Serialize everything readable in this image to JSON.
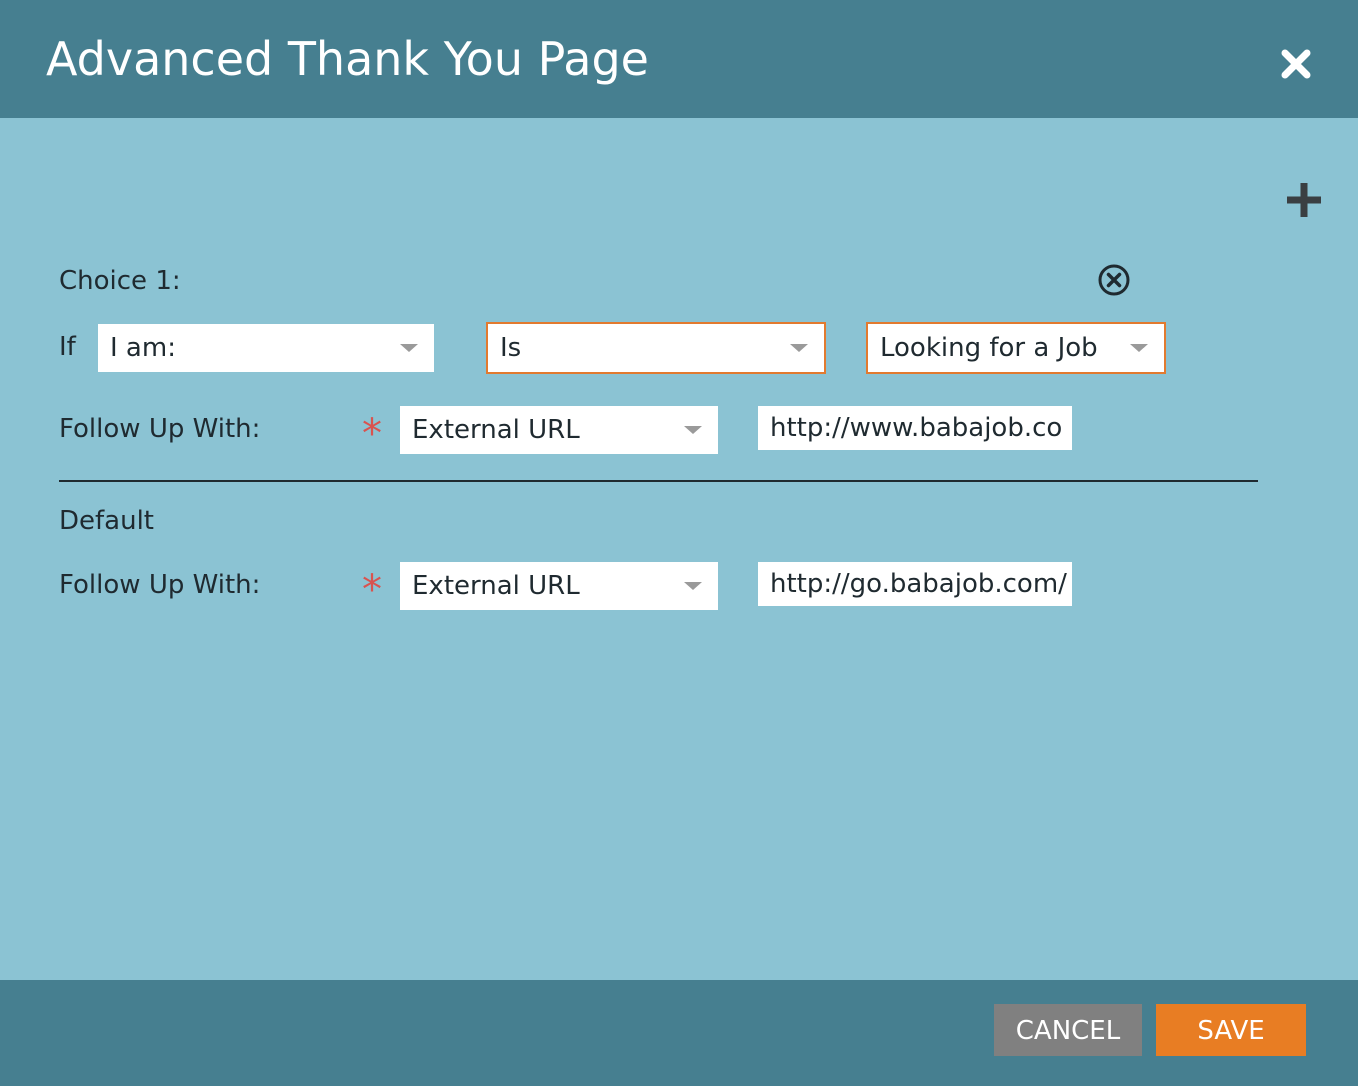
{
  "dialog": {
    "title": "Advanced Thank You Page"
  },
  "choices": [
    {
      "label": "Choice 1:",
      "if_label": "If",
      "field": "I am:",
      "operator": "Is",
      "value": "Looking for a Job",
      "follow_up_label": "Follow Up With:",
      "follow_up_type": "External URL",
      "url": "http://www.babajob.co"
    }
  ],
  "default": {
    "label": "Default",
    "follow_up_label": "Follow Up With:",
    "follow_up_type": "External URL",
    "url": "http://go.babajob.com/"
  },
  "required_marker": "*",
  "buttons": {
    "cancel": "CANCEL",
    "save": "SAVE"
  },
  "icons": {
    "close": "close-icon",
    "add": "plus-icon",
    "remove": "remove-circle-icon",
    "dropdown": "chevron-down-icon"
  },
  "colors": {
    "header": "#467f90",
    "body": "#8bc3d3",
    "highlight_border": "#e27a2f",
    "save_button": "#e87d23",
    "cancel_button": "#808080",
    "required": "#d9534f"
  }
}
